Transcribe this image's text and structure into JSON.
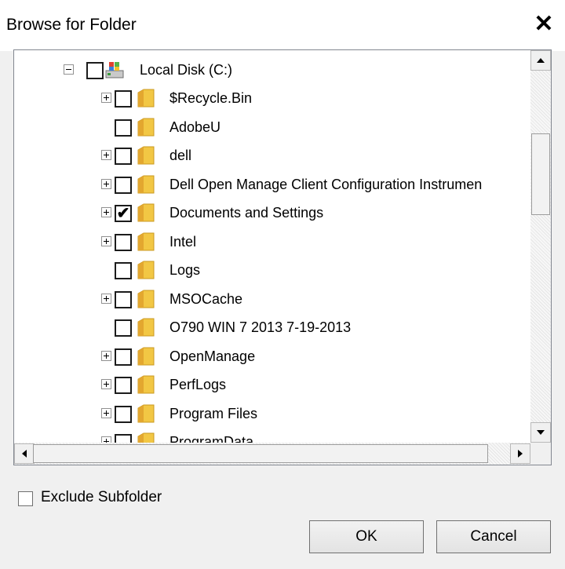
{
  "window": {
    "title": "Browse for Folder",
    "close_glyph": "✕"
  },
  "tree": {
    "root": {
      "label": "Local Disk (C:)",
      "icon": "drive-icon",
      "expanded": true,
      "checked": false
    },
    "items": [
      {
        "label": "$Recycle.Bin",
        "expandable": true,
        "checked": false
      },
      {
        "label": "AdobeU",
        "expandable": false,
        "checked": false
      },
      {
        "label": "dell",
        "expandable": true,
        "checked": false
      },
      {
        "label": "Dell Open Manage Client Configuration Instrumen",
        "expandable": true,
        "checked": false
      },
      {
        "label": "Documents and Settings",
        "expandable": true,
        "checked": true
      },
      {
        "label": "Intel",
        "expandable": true,
        "checked": false
      },
      {
        "label": "Logs",
        "expandable": false,
        "checked": false
      },
      {
        "label": "MSOCache",
        "expandable": true,
        "checked": false
      },
      {
        "label": "O790 WIN 7 2013 7-19-2013",
        "expandable": false,
        "checked": false
      },
      {
        "label": "OpenManage",
        "expandable": true,
        "checked": false
      },
      {
        "label": "PerfLogs",
        "expandable": true,
        "checked": false
      },
      {
        "label": "Program Files",
        "expandable": true,
        "checked": false
      },
      {
        "label": "ProgramData",
        "expandable": true,
        "checked": false
      }
    ]
  },
  "options": {
    "exclude_subfolder_label": "Exclude Subfolder",
    "exclude_subfolder_checked": false
  },
  "buttons": {
    "ok": "OK",
    "cancel": "Cancel"
  },
  "colors": {
    "folder_yellow": "#f2c744",
    "window_bg": "#f0f0f0"
  }
}
